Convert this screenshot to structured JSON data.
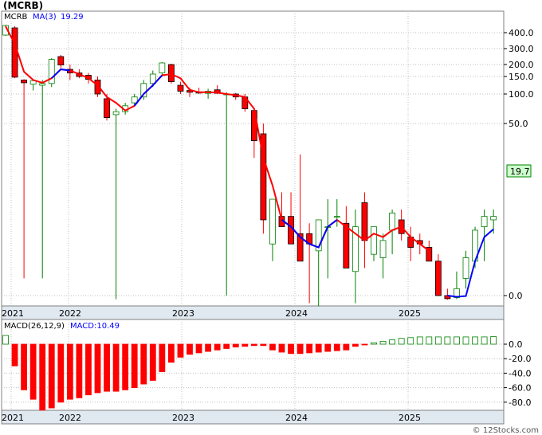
{
  "title": "(MCRB)",
  "watermark": "© 12Stocks.com",
  "colors": {
    "up": "#008000",
    "down": "#ff0000",
    "ma": "#0000ff",
    "ma_line": "#ff0000",
    "grid": "#c0c0c0",
    "axis_band": "#e0e8f0",
    "price_box": "#ccffcc"
  },
  "chart_data": [
    {
      "type": "candlestick",
      "legend": {
        "ticker": "MCRB",
        "ma_label": "MA(3)",
        "ma_value": "19.29"
      },
      "last_price_label": "19.7",
      "y_scale": "nonlinear",
      "y_ticks": [
        {
          "label": "400.0",
          "value": 400
        },
        {
          "label": "300.0",
          "value": 300
        },
        {
          "label": "200.0",
          "value": 200
        },
        {
          "label": "150.0",
          "value": 150
        },
        {
          "label": "100.0",
          "value": 100
        },
        {
          "label": "50.0",
          "value": 50
        },
        {
          "label": "0.0",
          "value": 0
        }
      ],
      "x_labels": [
        "2021",
        "2022",
        "2023",
        "2024",
        "2025"
      ],
      "candles": [
        {
          "o": 385,
          "h": 450,
          "l": 380,
          "c": 445
        },
        {
          "o": 430,
          "h": 440,
          "l": 145,
          "c": 148
        },
        {
          "o": 140,
          "h": 142,
          "l": 5,
          "c": 132
        },
        {
          "o": 128,
          "h": 138,
          "l": 110,
          "c": 138
        },
        {
          "o": 125,
          "h": 140,
          "l": 5,
          "c": 130
        },
        {
          "o": 130,
          "h": 240,
          "l": 120,
          "c": 232
        },
        {
          "o": 250,
          "h": 260,
          "l": 185,
          "c": 198
        },
        {
          "o": 180,
          "h": 200,
          "l": 140,
          "c": 165
        },
        {
          "o": 165,
          "h": 180,
          "l": 145,
          "c": 150
        },
        {
          "o": 155,
          "h": 165,
          "l": 130,
          "c": 142
        },
        {
          "o": 140,
          "h": 150,
          "l": 95,
          "c": 100
        },
        {
          "o": 92,
          "h": 100,
          "l": 55,
          "c": 60
        },
        {
          "o": 65,
          "h": 75,
          "l": -15,
          "c": 70
        },
        {
          "o": 70,
          "h": 85,
          "l": 65,
          "c": 80
        },
        {
          "o": 85,
          "h": 100,
          "l": 80,
          "c": 95
        },
        {
          "o": 95,
          "h": 140,
          "l": 90,
          "c": 130
        },
        {
          "o": 130,
          "h": 175,
          "l": 120,
          "c": 160
        },
        {
          "o": 165,
          "h": 215,
          "l": 150,
          "c": 210
        },
        {
          "o": 200,
          "h": 205,
          "l": 130,
          "c": 135
        },
        {
          "o": 125,
          "h": 135,
          "l": 100,
          "c": 108
        },
        {
          "o": 110,
          "h": 118,
          "l": 95,
          "c": 105
        },
        {
          "o": 105,
          "h": 118,
          "l": 100,
          "c": 103
        },
        {
          "o": 102,
          "h": 115,
          "l": 92,
          "c": 108
        },
        {
          "o": 112,
          "h": 125,
          "l": 100,
          "c": 102
        },
        {
          "o": 100,
          "h": 105,
          "l": 0,
          "c": 100
        },
        {
          "o": 100,
          "h": 103,
          "l": 90,
          "c": 95
        },
        {
          "o": 95,
          "h": 100,
          "l": 70,
          "c": 75
        },
        {
          "o": 72,
          "h": 75,
          "l": 40,
          "c": 45
        },
        {
          "o": 47,
          "h": 50,
          "l": 18,
          "c": 22
        },
        {
          "o": 15,
          "h": 25,
          "l": 10,
          "c": 28
        },
        {
          "o": 23,
          "h": 30,
          "l": 20,
          "c": 20
        },
        {
          "o": 23,
          "h": 30,
          "l": 18,
          "c": 15
        },
        {
          "o": 18,
          "h": 41,
          "l": 10,
          "c": 10
        },
        {
          "o": 18,
          "h": 21,
          "l": -32,
          "c": 15
        },
        {
          "o": 13,
          "h": 22,
          "l": -45,
          "c": 22
        },
        {
          "o": 20,
          "h": 28,
          "l": 5,
          "c": 20
        },
        {
          "o": 23,
          "h": 28,
          "l": 20,
          "c": 23
        },
        {
          "o": 21,
          "h": 26,
          "l": 10,
          "c": 8
        },
        {
          "o": 7,
          "h": 25,
          "l": -32,
          "c": 20
        },
        {
          "o": 27,
          "h": 30,
          "l": 8,
          "c": 16
        },
        {
          "o": 12,
          "h": 20,
          "l": 10,
          "c": 20
        },
        {
          "o": 11,
          "h": 18,
          "l": 5,
          "c": 16
        },
        {
          "o": 19,
          "h": 25,
          "l": 12,
          "c": 24
        },
        {
          "o": 22,
          "h": 25,
          "l": 16,
          "c": 18
        },
        {
          "o": 17,
          "h": 20,
          "l": 10,
          "c": 14
        },
        {
          "o": 16,
          "h": 18,
          "l": 12,
          "c": 15
        },
        {
          "o": 14,
          "h": 16,
          "l": 10,
          "c": 10
        },
        {
          "o": 10,
          "h": 12,
          "l": -2,
          "c": 0
        },
        {
          "o": 0,
          "h": 2,
          "l": -17,
          "c": -13
        },
        {
          "o": -9,
          "h": 7,
          "l": -15,
          "c": 2
        },
        {
          "o": 5,
          "h": 13,
          "l": 2,
          "c": 11
        },
        {
          "o": 10,
          "h": 20,
          "l": 8,
          "c": 19
        },
        {
          "o": 20,
          "h": 25,
          "l": 10,
          "c": 23
        },
        {
          "o": 22,
          "h": 25,
          "l": 18,
          "c": 23
        }
      ],
      "ma": [
        440,
        330,
        170,
        140,
        132,
        145,
        180,
        175,
        160,
        145,
        125,
        95,
        85,
        72,
        80,
        100,
        125,
        155,
        160,
        145,
        112,
        105,
        105,
        104,
        100,
        98,
        95,
        75,
        40,
        32,
        22,
        20,
        17,
        15,
        14,
        20,
        22,
        20,
        18,
        16,
        18,
        17,
        19,
        20,
        17,
        15,
        13,
        8,
        0,
        -5,
        -2,
        10,
        17,
        19.29
      ]
    },
    {
      "type": "bar",
      "legend": {
        "name": "MACD(26,12,9)",
        "label": "MACD:10.49"
      },
      "y_ticks": [
        {
          "label": "0.0",
          "value": 0
        },
        {
          "label": "-20.0",
          "value": -20
        },
        {
          "label": "-40.0",
          "value": -40
        },
        {
          "label": "-60.0",
          "value": -60
        },
        {
          "label": "-80.0",
          "value": -80
        }
      ],
      "x_labels": [
        "2021",
        "2022",
        "2023",
        "2024",
        "2025"
      ],
      "values": [
        12,
        -30,
        -63,
        -76,
        -91,
        -88,
        -80,
        -76,
        -74,
        -70,
        -67,
        -65,
        -65,
        -63,
        -60,
        -55,
        -50,
        -38,
        -25,
        -18,
        -14,
        -12,
        -10,
        -8,
        -6,
        -4,
        -3,
        -2,
        -2,
        -8,
        -11,
        -13,
        -13,
        -12,
        -11,
        -10,
        -9,
        -8,
        -3,
        -1,
        2,
        4,
        6,
        8,
        9,
        10,
        10,
        10,
        10,
        10,
        10,
        10,
        10,
        10.49
      ]
    }
  ]
}
